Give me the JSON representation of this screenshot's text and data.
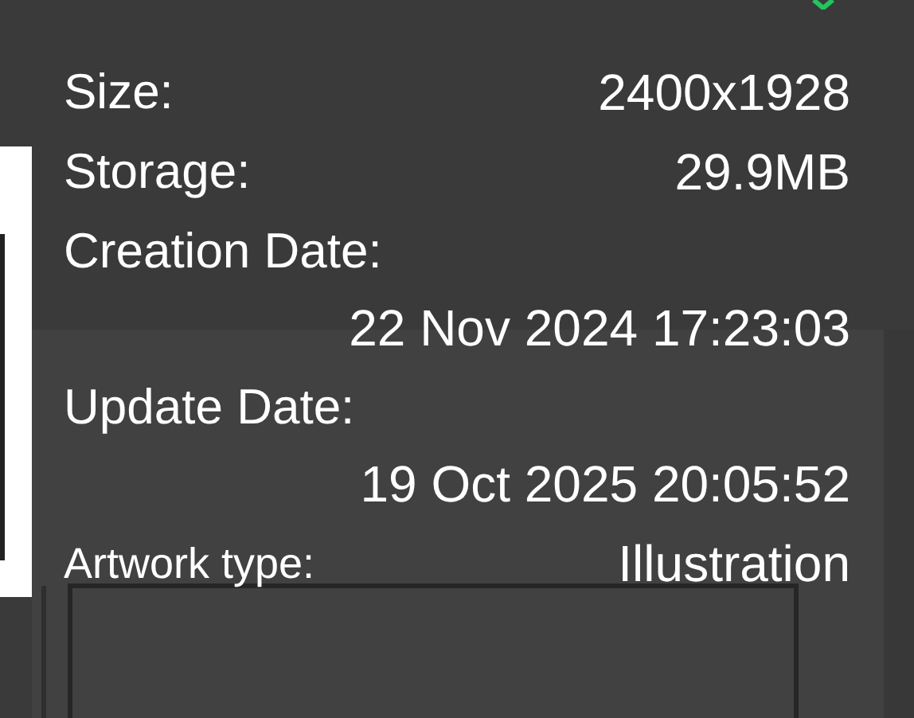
{
  "details": [
    {
      "kind": "inline",
      "label": "Size:",
      "value": "2400x1928"
    },
    {
      "kind": "inline",
      "label": "Storage:",
      "value": "29.9MB"
    },
    {
      "kind": "stacked",
      "label": "Creation Date:",
      "value": "22 Nov 2024 17:23:03"
    },
    {
      "kind": "stacked",
      "label": "Update Date:",
      "value": "19 Oct 2025 20:05:52"
    },
    {
      "kind": "inline",
      "label": "Artwork type:",
      "value": "Illustration"
    }
  ]
}
